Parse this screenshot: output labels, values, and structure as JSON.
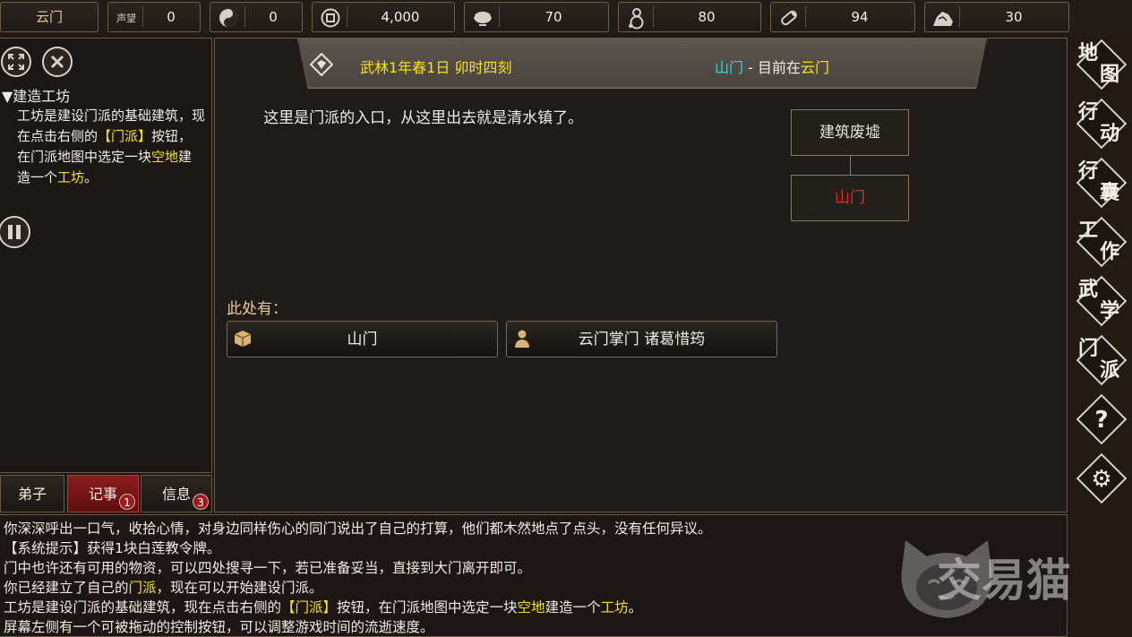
{
  "topbar": {
    "sect_name": "云门",
    "reputation_icon_text": "声望",
    "resources": [
      {
        "icon": "reputation-icon",
        "value": "0"
      },
      {
        "icon": "yinyang-icon",
        "value": "0"
      },
      {
        "icon": "coin-icon",
        "value": "4,000"
      },
      {
        "icon": "food-bowl-icon",
        "value": "70"
      },
      {
        "icon": "gourd-icon",
        "value": "80"
      },
      {
        "icon": "wood-icon",
        "value": "94"
      },
      {
        "icon": "stone-icon",
        "value": "30"
      }
    ]
  },
  "left": {
    "quest_title": "▼建造工坊",
    "quest_body": {
      "p1": "工坊是建设门派的基础建筑，现在点击右侧的",
      "hl1": "【门派】",
      "p2": "按钮，在门派地图中选定一块",
      "hl2": "空地",
      "p3": "建造一个",
      "hl3": "工坊",
      "p4": "。"
    },
    "tabs": [
      {
        "label": "弟子",
        "badge": ""
      },
      {
        "label": "记事",
        "badge": "1"
      },
      {
        "label": "信息",
        "badge": "3"
      }
    ]
  },
  "header": {
    "date": "武林1年春1日  卯时四刻",
    "location": "山门",
    "separator": " - ",
    "current_prefix": "目前在",
    "current_place": "云门"
  },
  "main": {
    "description": "这里是门派的入口，从这里出去就是清水镇了。",
    "map_nodes": [
      {
        "label": "建筑废墟",
        "current": false
      },
      {
        "label": "山门",
        "current": true
      }
    ],
    "here_label": "此处有：",
    "entities": [
      {
        "icon": "box-icon",
        "label": "山门"
      },
      {
        "icon": "person-icon",
        "label": "云门掌门 诸葛惜筠"
      }
    ]
  },
  "rightnav": [
    {
      "name": "map",
      "c1": "地",
      "c2": "图"
    },
    {
      "name": "action",
      "c1": "行",
      "c2": "动"
    },
    {
      "name": "bag",
      "c1": "行",
      "c2": "囊"
    },
    {
      "name": "work",
      "c1": "工",
      "c2": "作"
    },
    {
      "name": "martial",
      "c1": "武",
      "c2": "学"
    },
    {
      "name": "sect",
      "c1": "门",
      "c2": "派"
    },
    {
      "name": "help",
      "symbol": "?"
    },
    {
      "name": "settings",
      "symbol": "⚙"
    }
  ],
  "log": {
    "l1": "你深深呼出一口气，收拾心情，对身边同样伤心的同门说出了自己的打算，他们都木然地点了点头，没有任何异议。",
    "l2": "【系统提示】获得1块白莲教令牌。",
    "l3": "门中也许还有可用的物资，可以四处搜寻一下，若已准备妥当，直接到大门离开即可。",
    "l4a": "你已经建立了自己的",
    "l4b": "门派",
    "l4c": "，现在可以开始建设门派。",
    "l5a": "工坊是建设门派的基础建筑，现在点击右侧的",
    "l5b": "【门派】",
    "l5c": "按钮，在门派地图中选定一块",
    "l5d": "空地",
    "l5e": "建造一个",
    "l5f": "工坊",
    "l5g": "。",
    "l6": "屏幕左侧有一个可被拖动的控制按钮，可以调整游戏时间的流逝速度。"
  },
  "watermark": "交易猫",
  "colors": {
    "highlight_yellow": "#f6e11e",
    "highlight_cyan": "#37d3e0",
    "current_red": "#e22c2c",
    "border_gold": "#6a5a45"
  }
}
